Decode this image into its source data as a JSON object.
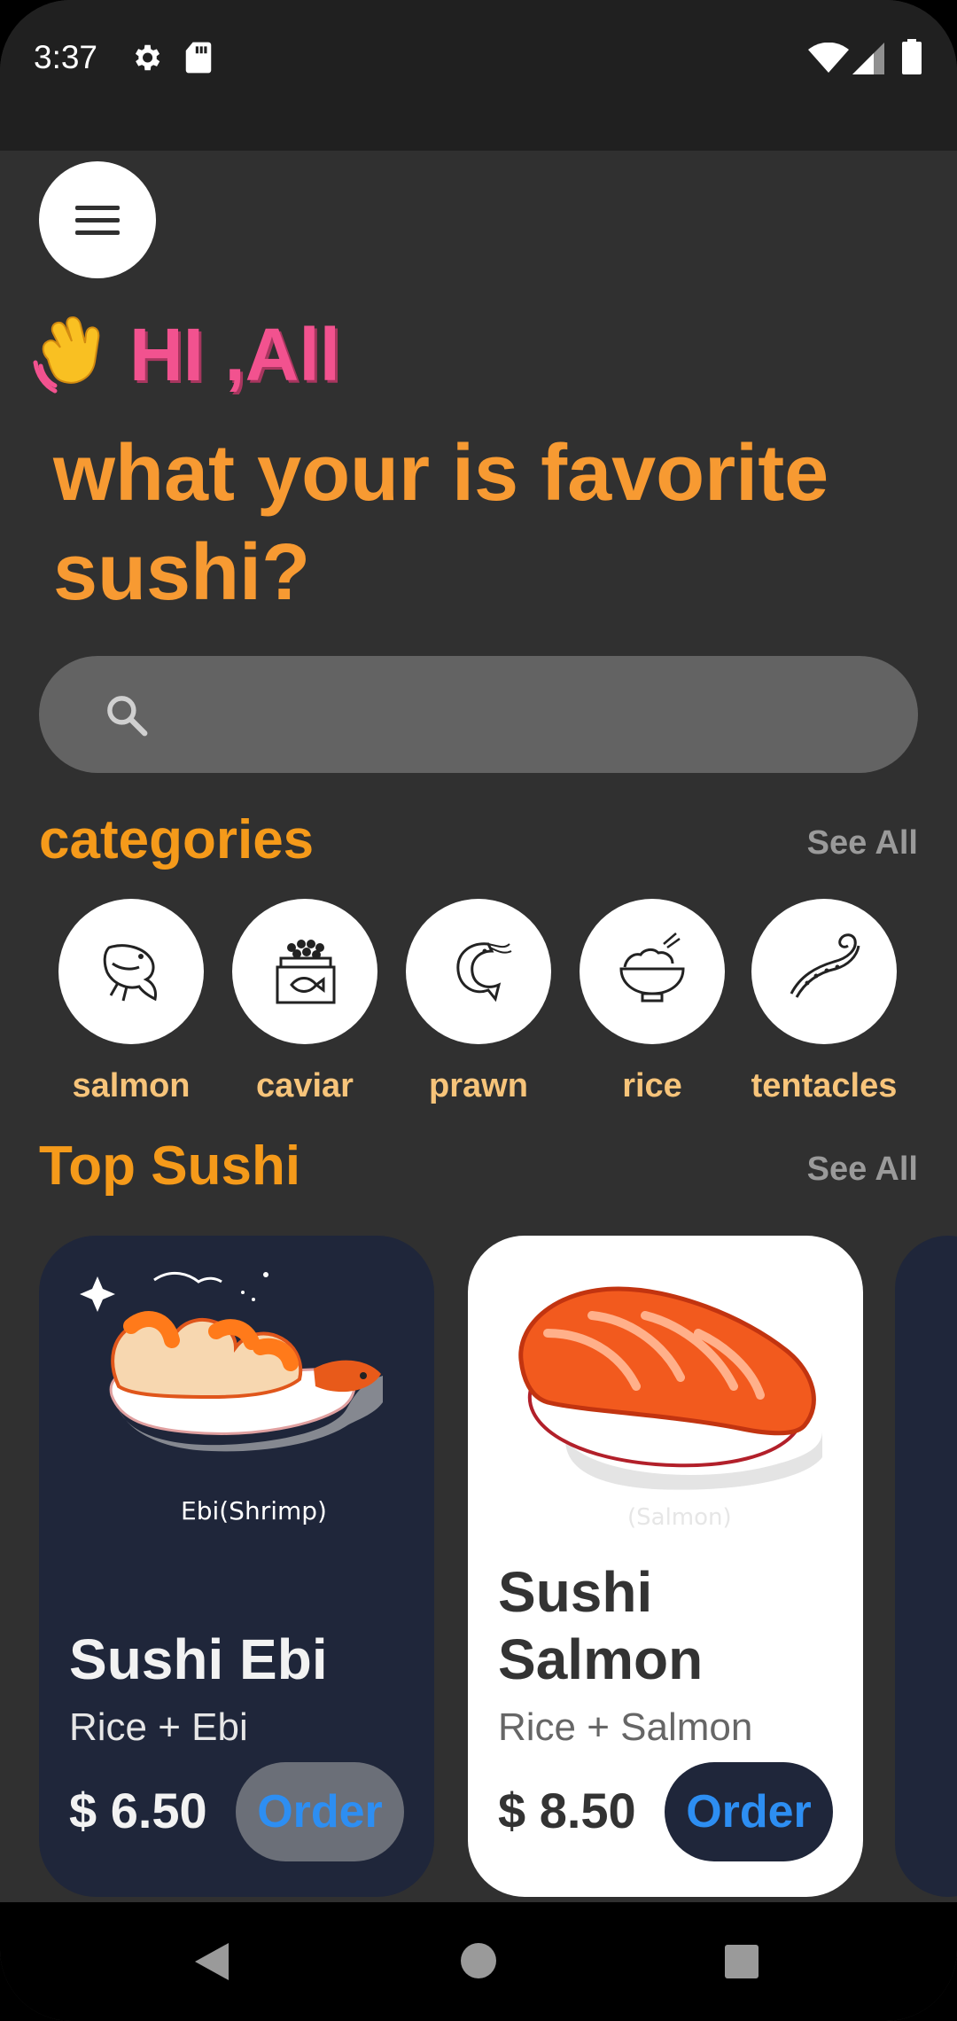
{
  "status_bar": {
    "time": "3:37"
  },
  "greeting": {
    "emoji": "waving-hand",
    "text": "HI ,All"
  },
  "headline": "what your is favorite sushi?",
  "search": {
    "placeholder": ""
  },
  "categories_section": {
    "title": "categories",
    "see_all": "See All"
  },
  "categories": [
    {
      "label": "salmon",
      "icon": "fish-icon"
    },
    {
      "label": "caviar",
      "icon": "caviar-icon"
    },
    {
      "label": "prawn",
      "icon": "prawn-icon"
    },
    {
      "label": "rice",
      "icon": "rice-bowl-icon"
    },
    {
      "label": "tentacles",
      "icon": "tentacle-icon"
    }
  ],
  "top_section": {
    "title": "Top Sushi",
    "see_all": "See All"
  },
  "top_sushi": [
    {
      "name": "Sushi Ebi",
      "description": "Rice + Ebi",
      "price": "$ 6.50",
      "button": "Order",
      "art_caption": "Ebi(Shrimp)",
      "theme": "dark"
    },
    {
      "name": "Sushi Salmon",
      "description": "Rice + Salmon",
      "price": "$ 8.50",
      "button": "Order",
      "art_caption": "(Salmon)",
      "theme": "light"
    }
  ],
  "colors": {
    "background": "#303030",
    "accent_orange": "#f79a32",
    "greeting_pink": "#f2528f",
    "card_dark": "#1f263a",
    "order_blue": "#2d8ef2"
  }
}
